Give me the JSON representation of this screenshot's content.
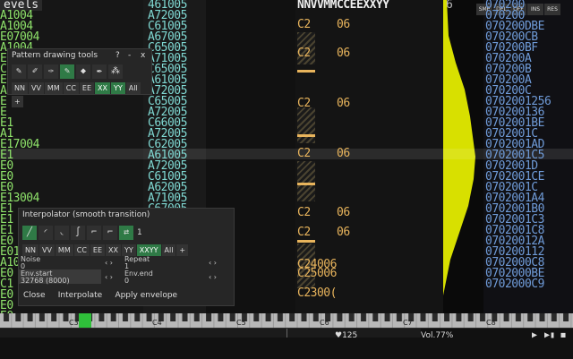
{
  "header": {
    "levels_title": "evels",
    "track_header": "NNVVMMCCEEXXYY",
    "track_header_num": "6",
    "top_buttons": [
      "SMP",
      "DEL",
      "OFF",
      "INS",
      "RES"
    ]
  },
  "col_left": {
    "rows": [
      "A1004",
      "A1004",
      "E07004",
      "A1004",
      "E0",
      "C1",
      "E0",
      "A1",
      "E",
      "E",
      "E1",
      "A1",
      "E17004",
      "E1",
      "E0",
      "E0",
      "E0",
      "E13004",
      "E1",
      "E1",
      "E1",
      "E0",
      "E01004",
      "A1004",
      "E0",
      "C1",
      "E0",
      "E0",
      "E0",
      "E0"
    ]
  },
  "col_mid": {
    "rows": [
      "461005",
      "A72005",
      "C61005",
      "A67005",
      "C65005",
      "A71005",
      "C65005",
      "A61005",
      "A72005",
      "C65005",
      "A72005",
      "C66005",
      "A72005",
      "C62005",
      "A61005",
      "A72005",
      "C61005",
      "A62005",
      "A71005",
      "C67005",
      "A72005"
    ]
  },
  "track": {
    "notes": [
      {
        "note": "C2",
        "vol": "06"
      },
      {
        "note": "C2",
        "vol": "06"
      },
      {
        "note": "C2",
        "vol": "06"
      },
      {
        "note": "C2",
        "vol": "06"
      },
      {
        "note": "C2",
        "vol": "06"
      },
      {
        "note": "C2",
        "vol": "06"
      }
    ],
    "bottom_notes": [
      "C24006",
      "C25006",
      "C2300("
    ]
  },
  "col_right": {
    "rows": [
      "070200",
      "070200",
      "070200DBE",
      "070200CB",
      "070200BF",
      "070200A",
      "070200B",
      "070200A",
      "070200C",
      "0702001256",
      "070200136",
      "0702001BE",
      "0702001C",
      "0702001AD",
      "0702001C5",
      "0702001D",
      "0702001CE",
      "0702001C",
      "0702001A4",
      "0702001B0",
      "0702001C3",
      "0702001C8",
      "07020012A",
      "070200112",
      "0702000C8",
      "0702000BE",
      "0702000C9"
    ]
  },
  "pattern_panel": {
    "title": "Pattern drawing tools",
    "help": "?",
    "min": "-",
    "close": "x",
    "params": [
      "NN",
      "VV",
      "MM",
      "CC",
      "EE",
      "XX",
      "YY",
      "All",
      "+"
    ],
    "active_params": [
      "XX",
      "YY"
    ]
  },
  "interp_panel": {
    "title": "Interpolator (smooth transition)",
    "count": "1",
    "params": [
      "NN",
      "VV",
      "MM",
      "CC",
      "EE",
      "XX",
      "YY",
      "XXYY",
      "All",
      "+"
    ],
    "active_params": [
      "XXYY"
    ],
    "noise_label": "Noise",
    "noise_value": "0",
    "repeat_label": "Repeat",
    "repeat_value": "1",
    "env_start_label": "Env.start",
    "env_start_value": "32768 (8000)",
    "env_end_label": "Env.end",
    "env_end_value": "0",
    "close_button": "Close",
    "interpolate_button": "Interpolate",
    "apply_button": "Apply envelope"
  },
  "octaves": [
    "C3",
    "C4",
    "C5",
    "C6",
    "C7",
    "C8"
  ],
  "status": {
    "bpm": "♥125",
    "volume": "Vol.77%"
  },
  "colors": {
    "green_text": "#8fe36b",
    "cyan_text": "#7fd8d2",
    "blue_text": "#6f9bd8",
    "orange_text": "#e8b45c",
    "yellow_wave": "#d8e000",
    "active_button": "#2f7a46"
  }
}
